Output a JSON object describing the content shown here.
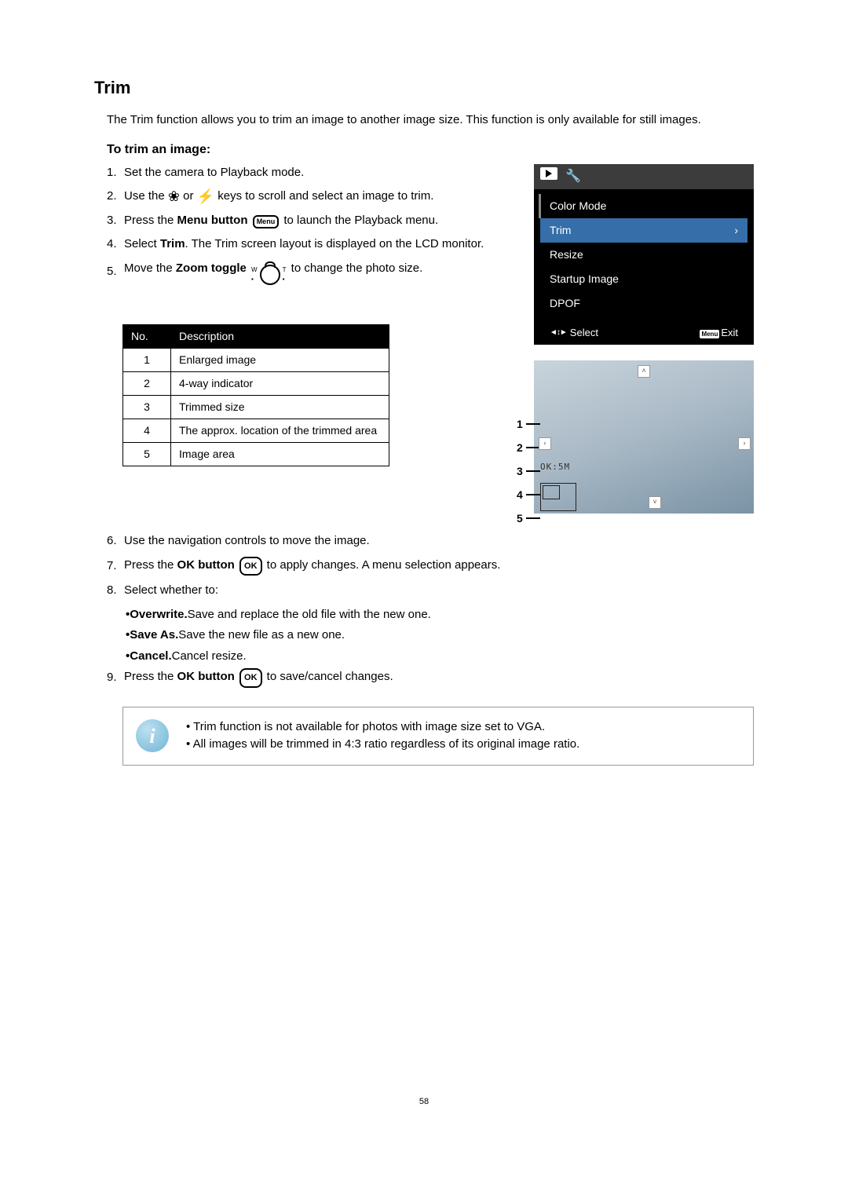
{
  "title": "Trim",
  "intro": "The Trim function allows you to trim an image to another image size. This function is only available for still images.",
  "subtitle": "To trim an image:",
  "steps": {
    "s1": "Set the camera to Playback mode.",
    "s2a": "Use the ",
    "s2b": " or ",
    "s2c": " keys to scroll and select an image to trim.",
    "s3a": "Press the ",
    "s3b": "Menu button",
    "s3c": " to launch the Playback menu.",
    "menu_label": "Menu",
    "s4a": "Select ",
    "s4b": "Trim",
    "s4c": ". The Trim screen layout is displayed on the LCD monitor.",
    "s5a": "Move the ",
    "s5b": "Zoom toggle",
    "s5c": " to change the photo size.",
    "s6": "Use the navigation controls to move the image.",
    "s7a": "Press the ",
    "s7b": "OK button",
    "s7c": " to apply changes. A menu selection appears.",
    "ok_label": "OK",
    "s8": "Select whether to:",
    "s8_1a": "Overwrite.",
    "s8_1b": " Save and replace the old file with the new one.",
    "s8_2a": "Save As.",
    "s8_2b": " Save the new file as a new one.",
    "s8_3a": "Cancel.",
    "s8_3b": " Cancel resize.",
    "s9a": "Press the ",
    "s9b": "OK button",
    "s9c": " to save/cancel changes."
  },
  "table": {
    "h1": "No.",
    "h2": "Description",
    "r1": "Enlarged image",
    "r2": "4-way indicator",
    "r3": "Trimmed size",
    "r4": "The approx. location of the trimmed area",
    "r5": "Image area"
  },
  "lcd": {
    "color_mode": "Color Mode",
    "trim": "Trim",
    "resize": "Resize",
    "startup": "Startup Image",
    "dpof": "DPOF",
    "select": "Select",
    "menu_badge": "Menu",
    "exit": "Exit",
    "ok5m": "OK:5M"
  },
  "info": {
    "n1": "Trim function is not available for photos with image size set to VGA.",
    "n2": "All images will be trimmed in 4:3 ratio regardless of its original image ratio."
  },
  "page_number": "58"
}
